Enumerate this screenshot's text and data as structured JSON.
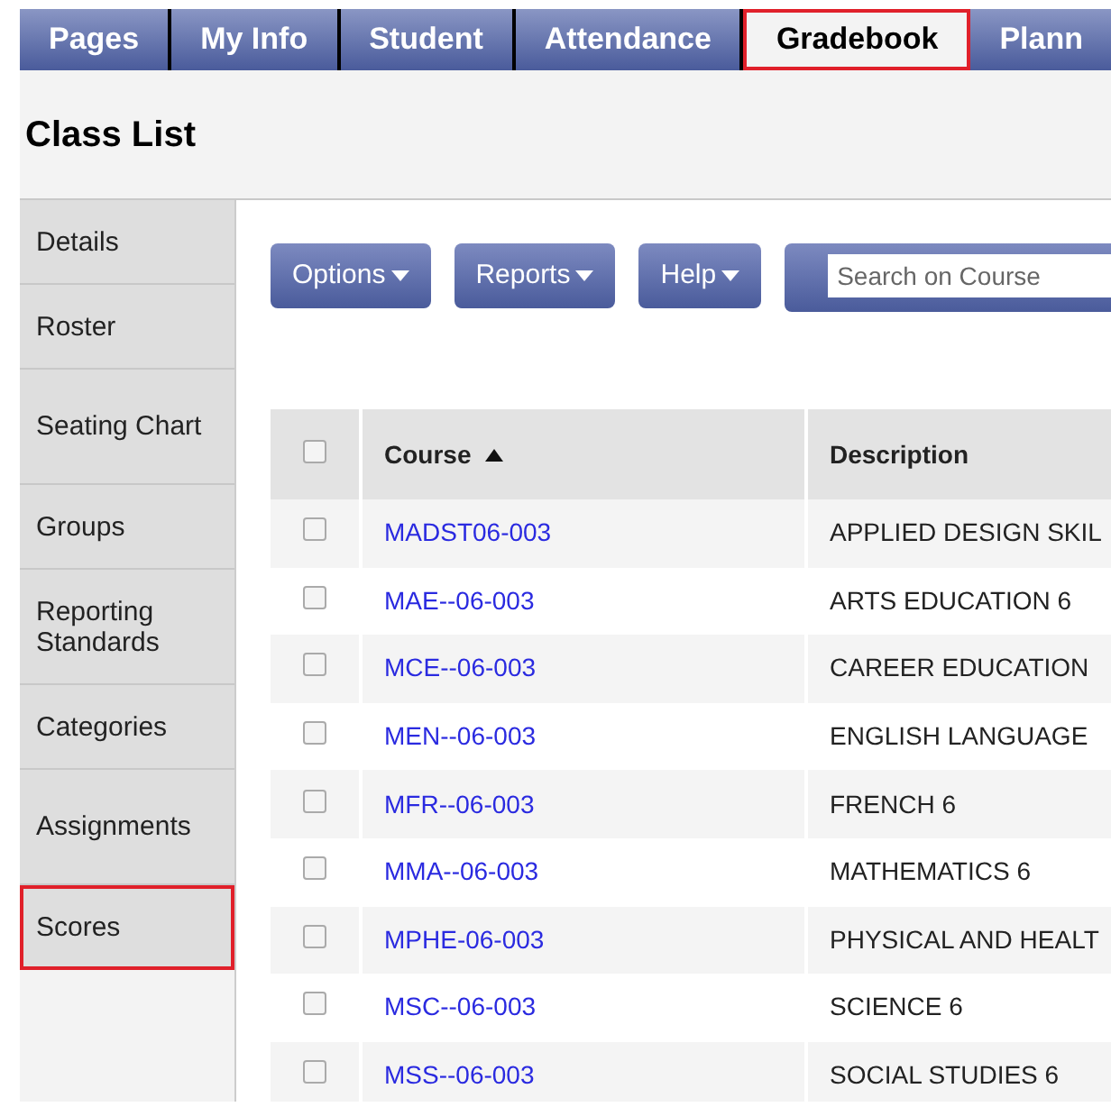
{
  "tabs": [
    {
      "label": "Pages",
      "selected": false,
      "highlighted": false
    },
    {
      "label": "My Info",
      "selected": false,
      "highlighted": false
    },
    {
      "label": "Student",
      "selected": false,
      "highlighted": false
    },
    {
      "label": "Attendance",
      "selected": false,
      "highlighted": false
    },
    {
      "label": "Gradebook",
      "selected": true,
      "highlighted": true
    },
    {
      "label": "Plann",
      "selected": false,
      "highlighted": false
    }
  ],
  "page_title": "Class List",
  "sidebar": {
    "items": [
      {
        "label": "Details",
        "highlighted": false
      },
      {
        "label": "Roster",
        "highlighted": false
      },
      {
        "label": "Seating Chart",
        "highlighted": false
      },
      {
        "label": "Groups",
        "highlighted": false
      },
      {
        "label": "Reporting Standards",
        "highlighted": false
      },
      {
        "label": "Categories",
        "highlighted": false
      },
      {
        "label": "Assignments",
        "highlighted": false
      },
      {
        "label": "Scores",
        "highlighted": true
      }
    ]
  },
  "toolbar": {
    "buttons": [
      "Options",
      "Reports",
      "Help"
    ],
    "search": {
      "placeholder": "Search on Course"
    }
  },
  "table": {
    "select_all_checked": false,
    "columns": [
      {
        "label": "Course",
        "sorted": true
      },
      {
        "label": "Description",
        "sorted": false
      }
    ],
    "rows": [
      {
        "course": "MADST06-003",
        "description": "APPLIED DESIGN SKIL",
        "checked": false
      },
      {
        "course": "MAE--06-003",
        "description": "ARTS EDUCATION 6",
        "checked": false
      },
      {
        "course": "MCE--06-003",
        "description": "CAREER EDUCATION",
        "checked": false
      },
      {
        "course": "MEN--06-003",
        "description": "ENGLISH LANGUAGE",
        "checked": false
      },
      {
        "course": "MFR--06-003",
        "description": "FRENCH 6",
        "checked": false
      },
      {
        "course": "MMA--06-003",
        "description": "MATHEMATICS 6",
        "checked": false
      },
      {
        "course": "MPHE-06-003",
        "description": "PHYSICAL AND HEALT",
        "checked": false
      },
      {
        "course": "MSC--06-003",
        "description": "SCIENCE 6",
        "checked": false
      },
      {
        "course": "MSS--06-003",
        "description": "SOCIAL STUDIES 6",
        "checked": false
      }
    ]
  }
}
